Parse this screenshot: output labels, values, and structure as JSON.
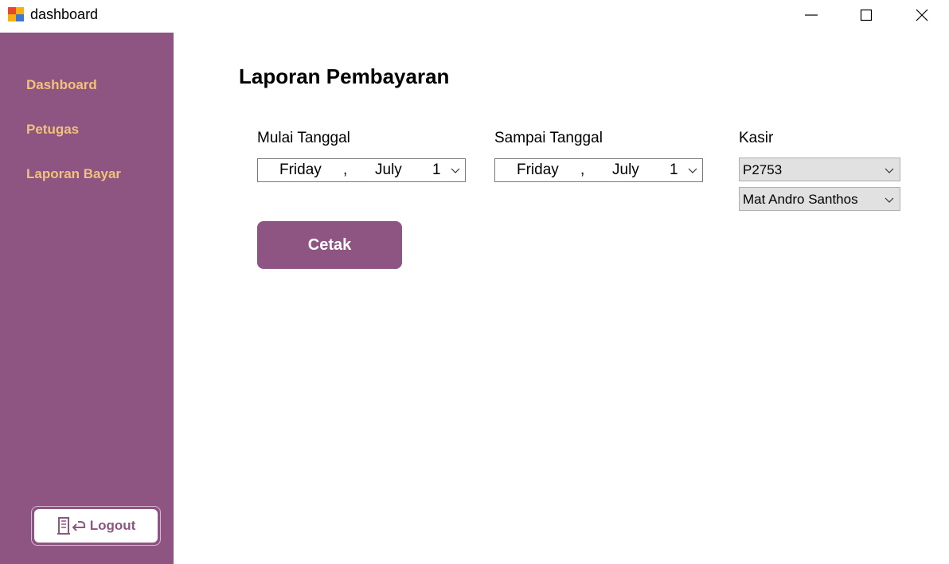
{
  "window": {
    "title": "dashboard",
    "icon": "app-windows-icon"
  },
  "colors": {
    "sidebar_bg": "#8e5582",
    "nav_text": "#f2c27c",
    "accent": "#8e5582"
  },
  "sidebar": {
    "items": [
      {
        "label": "Dashboard"
      },
      {
        "label": "Petugas"
      },
      {
        "label": "Laporan Bayar"
      }
    ],
    "logout": {
      "icon": "door-exit-icon",
      "label": "Logout"
    }
  },
  "main": {
    "title": "Laporan Pembayaran",
    "start_date": {
      "label": "Mulai Tanggal",
      "day": "Friday",
      "sep": ",",
      "month": "July",
      "date": "1"
    },
    "end_date": {
      "label": "Sampai Tanggal",
      "day": "Friday",
      "sep": ",",
      "month": "July",
      "date": "1"
    },
    "kasir": {
      "label": "Kasir",
      "id_selected": "P2753",
      "name_selected": "Mat Andro Santhos"
    },
    "print_button": "Cetak"
  }
}
